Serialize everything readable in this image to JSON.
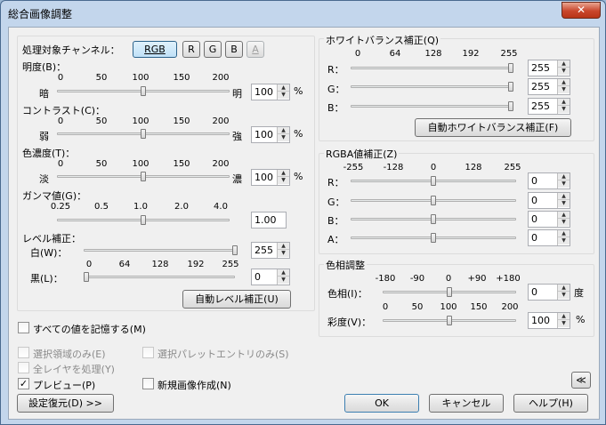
{
  "window": {
    "title": "総合画像調整",
    "close": "✕"
  },
  "channel": {
    "label": "処理対象チャンネル：",
    "buttons": [
      "RGB",
      "R",
      "G",
      "B",
      "A"
    ]
  },
  "brightness": {
    "label": "明度(B)：",
    "ticks": [
      "0",
      "50",
      "100",
      "150",
      "200"
    ],
    "left": "暗",
    "right": "明",
    "value": "100",
    "unit": "%",
    "level": 0.5
  },
  "contrast": {
    "label": "コントラスト(C)：",
    "ticks": [
      "0",
      "50",
      "100",
      "150",
      "200"
    ],
    "left": "弱",
    "right": "強",
    "value": "100",
    "unit": "%",
    "level": 0.5
  },
  "saturation": {
    "label": "色濃度(T)：",
    "ticks": [
      "0",
      "50",
      "100",
      "150",
      "200"
    ],
    "left": "淡",
    "right": "濃",
    "value": "100",
    "unit": "%",
    "level": 0.5
  },
  "gamma": {
    "label": "ガンマ値(G)：",
    "ticks": [
      "0.25",
      "0.5",
      "1.0",
      "2.0",
      "4.0"
    ],
    "value": "1.00",
    "level": 0.5
  },
  "level": {
    "label": "レベル補正：",
    "white_label": "白(W)：",
    "white_value": "255",
    "white_level": 1.0,
    "ticks": [
      "0",
      "64",
      "128",
      "192",
      "255"
    ],
    "black_label": "黒(L)：",
    "black_value": "0",
    "black_level": 0.0,
    "auto_button": "自動レベル補正(U)"
  },
  "white_balance": {
    "title": "ホワイトバランス補正(Q)",
    "ticks": [
      "0",
      "64",
      "128",
      "192",
      "255"
    ],
    "rows": [
      {
        "label": "R：",
        "value": "255",
        "level": 1.0
      },
      {
        "label": "G：",
        "value": "255",
        "level": 1.0
      },
      {
        "label": "B：",
        "value": "255",
        "level": 1.0
      }
    ],
    "auto_button": "自動ホワイトバランス補正(F)"
  },
  "rgba": {
    "title": "RGBA値補正(Z)",
    "ticks": [
      "-255",
      "-128",
      "0",
      "128",
      "255"
    ],
    "rows": [
      {
        "label": "R：",
        "value": "0",
        "level": 0.5
      },
      {
        "label": "G：",
        "value": "0",
        "level": 0.5
      },
      {
        "label": "B：",
        "value": "0",
        "level": 0.5
      },
      {
        "label": "A：",
        "value": "0",
        "level": 0.5
      }
    ]
  },
  "hue_adjust": {
    "title": "色相調整",
    "hue_ticks": [
      "-180",
      "-90",
      "0",
      "+90",
      "+180"
    ],
    "hue_label": "色相(I)：",
    "hue_value": "0",
    "hue_unit": "度",
    "hue_level": 0.5,
    "sat_ticks": [
      "0",
      "50",
      "100",
      "150",
      "200"
    ],
    "sat_label": "彩度(V)：",
    "sat_value": "100",
    "sat_unit": "%",
    "sat_level": 0.5
  },
  "options": {
    "remember_all": "すべての値を記憶する(M)",
    "selection_only": "選択領域のみ(E)",
    "palette_only": "選択パレットエントリのみ(S)",
    "all_layers": "全レイヤを処理(Y)",
    "preview": "プレビュー(P)",
    "new_image": "新規画像作成(N)",
    "check": "✓"
  },
  "footer": {
    "restore": "設定復元(D) >>",
    "ok": "OK",
    "cancel": "キャンセル",
    "help": "ヘルプ(H)",
    "collapse": "≪"
  }
}
